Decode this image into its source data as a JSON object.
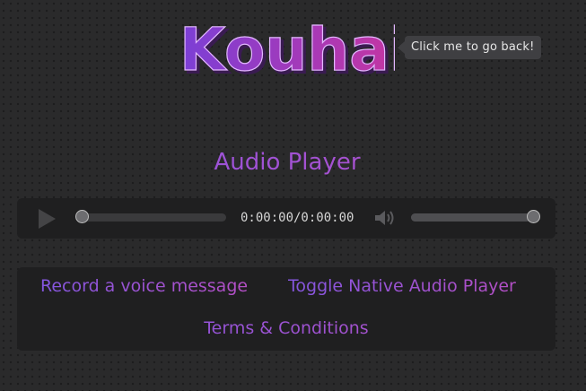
{
  "header": {
    "logo_text": "Kouhai",
    "back_tooltip": "Click me to go back!"
  },
  "main": {
    "title": "Audio Player"
  },
  "player": {
    "play_icon": "play-icon",
    "time_display": "0:00:00/0:00:00",
    "progress": 0,
    "volume_icon": "volume-icon",
    "volume_level": 1.0
  },
  "links": {
    "record": "Record a voice message",
    "toggle": "Toggle Native Audio Player",
    "terms": "Terms & Conditions"
  },
  "colors": {
    "background": "#2a2a2b",
    "panel": "#1f1f20",
    "accent_start": "#8456df",
    "accent_end": "#b44fc5"
  }
}
